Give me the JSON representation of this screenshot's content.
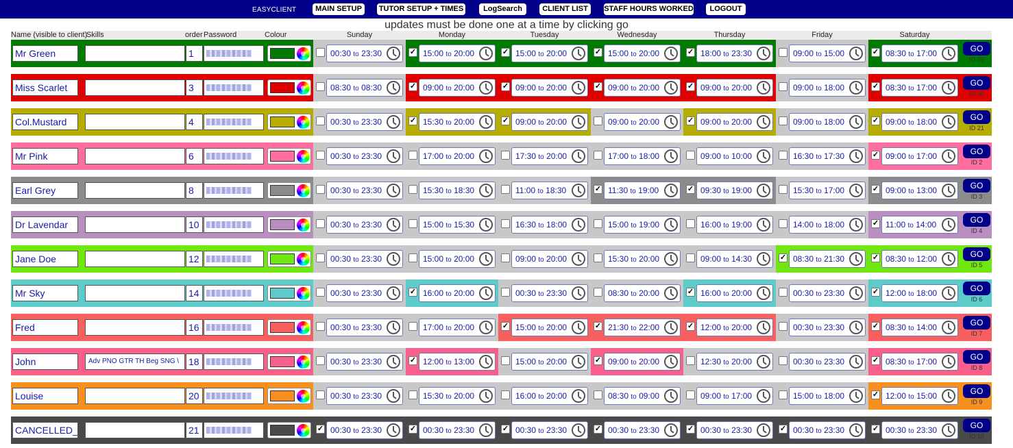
{
  "nav": {
    "brand": "EASYCLIENT",
    "items": [
      "MAIN SETUP",
      "TUTOR SETUP + TIMES",
      "LogSearch",
      "CLIENT LIST",
      "STAFF HOURS WORKED",
      "LOGOUT"
    ]
  },
  "notice": "updates must be done one at a time by clicking go",
  "headers": {
    "name": "Name (visible to client)",
    "skills": "Skills",
    "order": "order",
    "password": "Password",
    "colour": "Colour",
    "days": [
      "Sunday",
      "Monday",
      "Tuesday",
      "Wednesday",
      "Thursday",
      "Friday",
      "Saturday"
    ]
  },
  "time_separator": "to",
  "go_label": "GO",
  "tutors": [
    {
      "name": "Mr Green",
      "skills": "",
      "order": "1",
      "color": "#007a00",
      "id": "ID 23",
      "days": [
        {
          "c": false,
          "s": "00:30",
          "e": "23:30"
        },
        {
          "c": true,
          "s": "15:00",
          "e": "20:00"
        },
        {
          "c": true,
          "s": "15:00",
          "e": "20:00"
        },
        {
          "c": true,
          "s": "15:00",
          "e": "20:00"
        },
        {
          "c": true,
          "s": "18:00",
          "e": "23:30"
        },
        {
          "c": false,
          "s": "09:00",
          "e": "15:00"
        },
        {
          "c": true,
          "s": "08:30",
          "e": "17:00"
        }
      ]
    },
    {
      "name": "Miss Scarlet",
      "skills": "",
      "order": "3",
      "color": "#e00000",
      "id": "ID 30",
      "days": [
        {
          "c": false,
          "s": "08:30",
          "e": "08:30"
        },
        {
          "c": true,
          "s": "09:00",
          "e": "20:00"
        },
        {
          "c": true,
          "s": "09:00",
          "e": "20:00"
        },
        {
          "c": true,
          "s": "09:00",
          "e": "20:00"
        },
        {
          "c": true,
          "s": "09:00",
          "e": "20:00"
        },
        {
          "c": false,
          "s": "09:00",
          "e": "18:00"
        },
        {
          "c": true,
          "s": "08:30",
          "e": "17:00"
        }
      ]
    },
    {
      "name": "Col.Mustard",
      "skills": "",
      "order": "4",
      "color": "#b5ad00",
      "id": "ID 21",
      "days": [
        {
          "c": false,
          "s": "00:30",
          "e": "23:30"
        },
        {
          "c": true,
          "s": "15:30",
          "e": "20:00"
        },
        {
          "c": true,
          "s": "09:00",
          "e": "20:00"
        },
        {
          "c": false,
          "s": "09:00",
          "e": "20:00"
        },
        {
          "c": true,
          "s": "09:00",
          "e": "20:00"
        },
        {
          "c": false,
          "s": "09:00",
          "e": "18:00"
        },
        {
          "c": true,
          "s": "09:00",
          "e": "18:00"
        }
      ]
    },
    {
      "name": "Mr Pink",
      "skills": "",
      "order": "6",
      "color": "#ff6e9e",
      "id": "ID 2",
      "days": [
        {
          "c": false,
          "s": "00:30",
          "e": "23:30"
        },
        {
          "c": false,
          "s": "17:00",
          "e": "20:00"
        },
        {
          "c": false,
          "s": "17:30",
          "e": "20:00"
        },
        {
          "c": false,
          "s": "17:00",
          "e": "18:00"
        },
        {
          "c": false,
          "s": "09:00",
          "e": "10:00"
        },
        {
          "c": false,
          "s": "16:30",
          "e": "17:30"
        },
        {
          "c": true,
          "s": "09:00",
          "e": "17:00"
        }
      ]
    },
    {
      "name": "Earl Grey",
      "skills": "",
      "order": "8",
      "color": "#8c8c8c",
      "id": "ID 3",
      "days": [
        {
          "c": false,
          "s": "00:30",
          "e": "23:30"
        },
        {
          "c": false,
          "s": "15:30",
          "e": "18:30"
        },
        {
          "c": false,
          "s": "11:00",
          "e": "18:30"
        },
        {
          "c": true,
          "s": "11:30",
          "e": "19:00"
        },
        {
          "c": true,
          "s": "09:30",
          "e": "19:00"
        },
        {
          "c": false,
          "s": "15:30",
          "e": "17:00"
        },
        {
          "c": true,
          "s": "09:00",
          "e": "13:00"
        }
      ]
    },
    {
      "name": "Dr Lavendar",
      "skills": "",
      "order": "10",
      "color": "#b98fc0",
      "id": "ID 4",
      "days": [
        {
          "c": false,
          "s": "00:30",
          "e": "23:30"
        },
        {
          "c": false,
          "s": "15:00",
          "e": "15:30"
        },
        {
          "c": false,
          "s": "16:30",
          "e": "18:00"
        },
        {
          "c": false,
          "s": "15:00",
          "e": "19:00"
        },
        {
          "c": false,
          "s": "16:00",
          "e": "19:00"
        },
        {
          "c": false,
          "s": "14:00",
          "e": "18:00"
        },
        {
          "c": true,
          "s": "11:00",
          "e": "14:00"
        }
      ]
    },
    {
      "name": "Jane Doe",
      "skills": "",
      "order": "12",
      "color": "#70e810",
      "id": "ID 5",
      "days": [
        {
          "c": false,
          "s": "00:30",
          "e": "23:30"
        },
        {
          "c": false,
          "s": "15:00",
          "e": "20:00"
        },
        {
          "c": false,
          "s": "09:00",
          "e": "20:00"
        },
        {
          "c": false,
          "s": "15:30",
          "e": "20:00"
        },
        {
          "c": false,
          "s": "09:00",
          "e": "14:30"
        },
        {
          "c": true,
          "s": "08:30",
          "e": "21:30"
        },
        {
          "c": true,
          "s": "08:30",
          "e": "12:00"
        }
      ]
    },
    {
      "name": "Mr Sky",
      "skills": "",
      "order": "14",
      "color": "#5ecbcb",
      "id": "ID 6",
      "days": [
        {
          "c": false,
          "s": "00:30",
          "e": "23:30"
        },
        {
          "c": true,
          "s": "16:00",
          "e": "20:00"
        },
        {
          "c": false,
          "s": "00:30",
          "e": "23:30"
        },
        {
          "c": false,
          "s": "08:30",
          "e": "20:00"
        },
        {
          "c": true,
          "s": "16:00",
          "e": "20:00"
        },
        {
          "c": false,
          "s": "00:30",
          "e": "23:30"
        },
        {
          "c": true,
          "s": "12:00",
          "e": "18:00"
        }
      ]
    },
    {
      "name": "Fred",
      "skills": "",
      "order": "16",
      "color": "#f86060",
      "id": "ID 7",
      "days": [
        {
          "c": false,
          "s": "00:30",
          "e": "23:30"
        },
        {
          "c": false,
          "s": "17:00",
          "e": "20:00"
        },
        {
          "c": true,
          "s": "15:00",
          "e": "20:00"
        },
        {
          "c": true,
          "s": "21:30",
          "e": "22:00"
        },
        {
          "c": true,
          "s": "12:00",
          "e": "20:00"
        },
        {
          "c": false,
          "s": "00:30",
          "e": "23:30"
        },
        {
          "c": true,
          "s": "08:30",
          "e": "14:00"
        }
      ]
    },
    {
      "name": "John",
      "skills": "Adv PNO GTR TH Beg SNG \\",
      "order": "18",
      "color": "#f8608c",
      "id": "ID 8",
      "days": [
        {
          "c": false,
          "s": "00:30",
          "e": "23:30"
        },
        {
          "c": true,
          "s": "12:00",
          "e": "13:00"
        },
        {
          "c": false,
          "s": "15:00",
          "e": "20:00"
        },
        {
          "c": true,
          "s": "09:00",
          "e": "20:00"
        },
        {
          "c": false,
          "s": "12:30",
          "e": "20:00"
        },
        {
          "c": false,
          "s": "00:30",
          "e": "23:30"
        },
        {
          "c": true,
          "s": "08:30",
          "e": "17:00"
        }
      ]
    },
    {
      "name": "Louise",
      "skills": "",
      "order": "20",
      "color": "#f89020",
      "id": "ID 9",
      "days": [
        {
          "c": false,
          "s": "00:30",
          "e": "23:30"
        },
        {
          "c": false,
          "s": "15:30",
          "e": "20:00"
        },
        {
          "c": false,
          "s": "16:00",
          "e": "20:00"
        },
        {
          "c": false,
          "s": "08:30",
          "e": "09:00"
        },
        {
          "c": false,
          "s": "09:00",
          "e": "17:00"
        },
        {
          "c": false,
          "s": "15:00",
          "e": "18:00"
        },
        {
          "c": true,
          "s": "12:00",
          "e": "15:00"
        }
      ]
    },
    {
      "name": "CANCELLED_",
      "skills": "",
      "order": "21",
      "color": "#4a4a4a",
      "id": "ID 18",
      "days": [
        {
          "c": true,
          "s": "00:30",
          "e": "23:30"
        },
        {
          "c": true,
          "s": "00:30",
          "e": "23:30"
        },
        {
          "c": true,
          "s": "00:30",
          "e": "23:30"
        },
        {
          "c": true,
          "s": "00:30",
          "e": "23:30"
        },
        {
          "c": true,
          "s": "00:30",
          "e": "23:30"
        },
        {
          "c": true,
          "s": "00:30",
          "e": "23:30"
        },
        {
          "c": true,
          "s": "00:30",
          "e": "23:30"
        }
      ]
    }
  ],
  "colors": {
    "nav_bar": "#00008b",
    "inactive_day": "#c8c8c8",
    "go_button": "#00008b",
    "text_blue": "#1a1aa6"
  }
}
